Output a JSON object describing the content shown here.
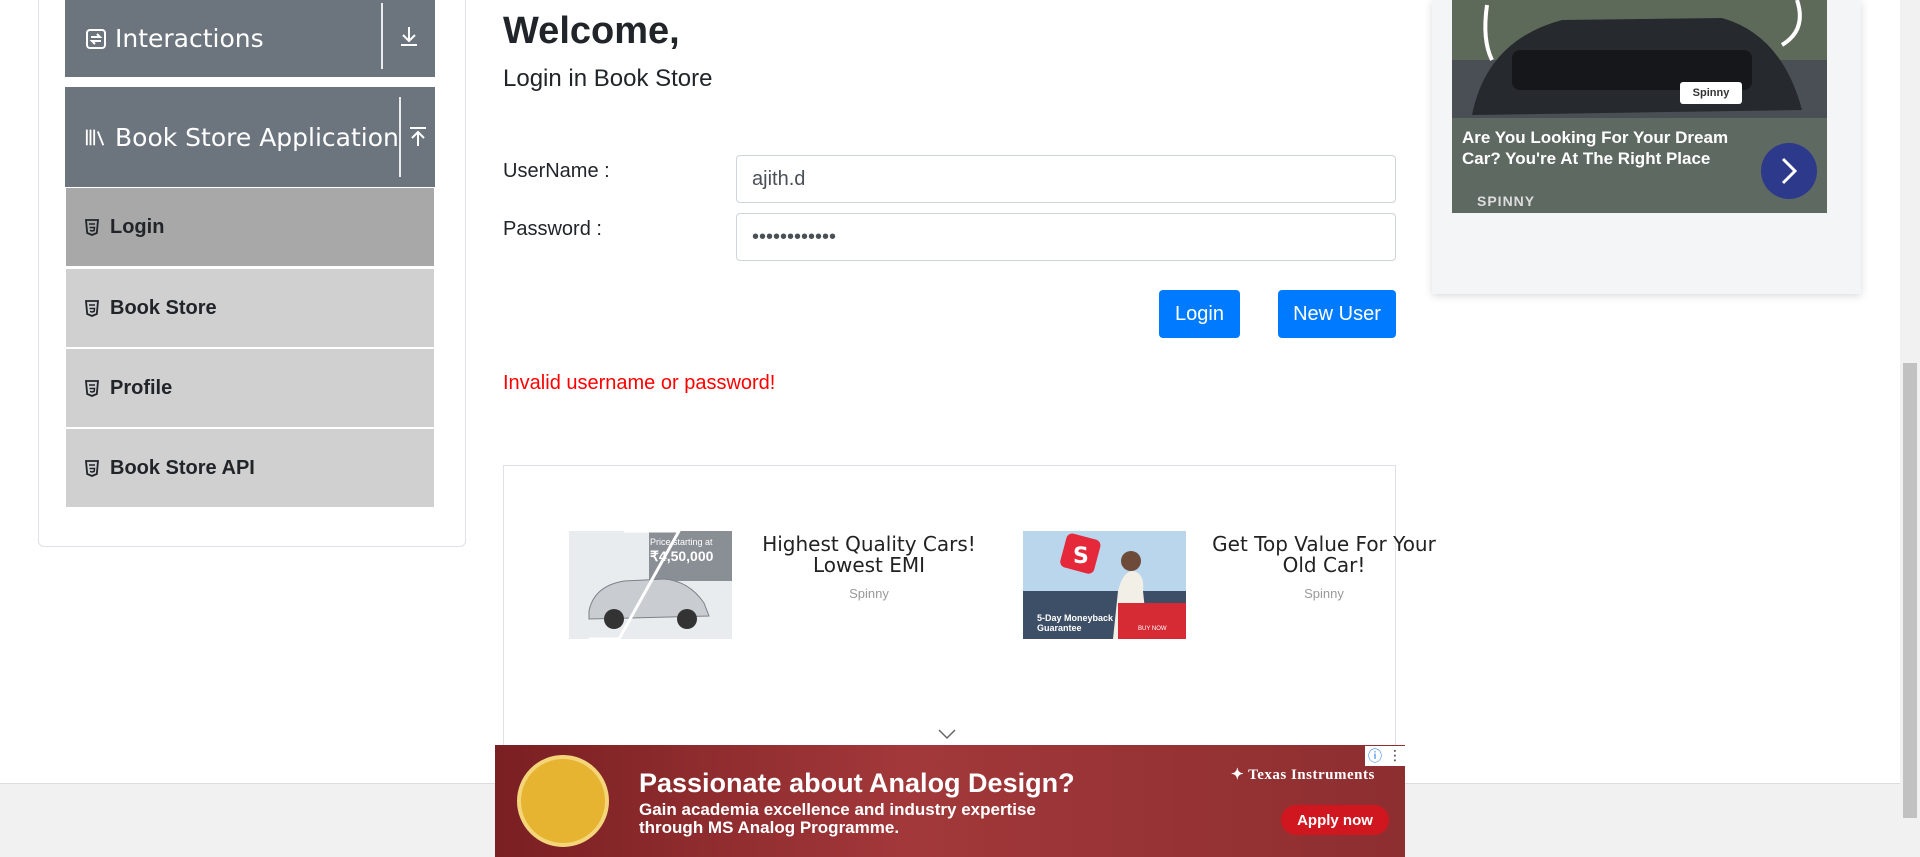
{
  "sidebar": {
    "groups": [
      {
        "label": "Interactions",
        "icon": "refresh-icon",
        "toggle_icon": "arrow-down-icon"
      },
      {
        "label": "Book Store Application",
        "icon": "books-icon",
        "toggle_icon": "arrow-up-icon"
      }
    ],
    "items": [
      {
        "label": "Login",
        "active": true
      },
      {
        "label": "Book Store",
        "active": false
      },
      {
        "label": "Profile",
        "active": false
      },
      {
        "label": "Book Store API",
        "active": false
      }
    ]
  },
  "main": {
    "welcome": "Welcome,",
    "subtitle": "Login in Book Store",
    "username_label": "UserName :",
    "username_value": "ajith.d",
    "password_label": "Password :",
    "password_value": "••••••••••••",
    "login_button": "Login",
    "new_user_button": "New User",
    "error_message": "Invalid username or password!"
  },
  "ads": {
    "cards": [
      {
        "title": "Highest Quality Cars! Lowest EMI",
        "source": "Spinny",
        "image_text": "Price starting at",
        "image_price": "₹4,50,000"
      },
      {
        "title": "Get Top Value For Your Old Car!",
        "source": "Spinny",
        "image_text": "5-Day Moneyback Guarantee",
        "image_badge": "BUY NOW"
      }
    ],
    "right_ad": {
      "text": "Are You Looking For Your Dream Car? You're At The Right Place",
      "brand": "SPINNY",
      "plate": "Spinny"
    },
    "banner": {
      "title": "Passionate about Analog Design?",
      "subtitle": "Gain academia excellence and industry expertise through MS Analog Programme.",
      "brand": "Texas Instruments",
      "cta": "Apply now"
    }
  },
  "colors": {
    "primary": "#007bff",
    "error": "#ff0000",
    "group_header": "#6c757d",
    "menu_item": "#d0d0d0",
    "menu_item_active": "#a8a8a8"
  }
}
